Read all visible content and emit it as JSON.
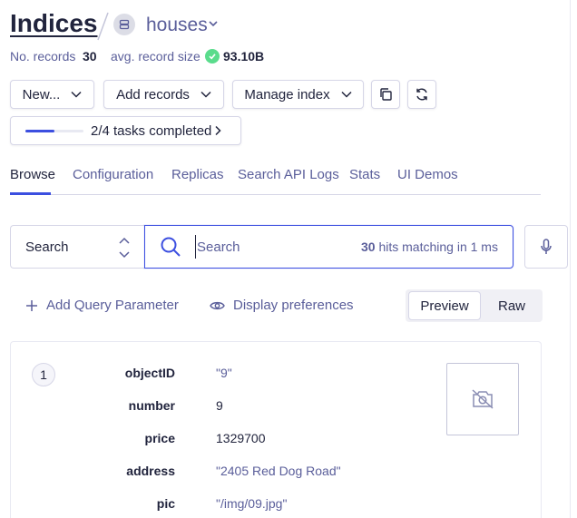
{
  "header": {
    "title": "Indices",
    "index_name": "houses",
    "records_label": "No. records",
    "records_value": "30",
    "size_label": "avg. record size",
    "size_value": "93.10B"
  },
  "toolbar": {
    "new_label": "New...",
    "add_records_label": "Add records",
    "manage_index_label": "Manage index"
  },
  "tasks": {
    "label": "2/4 tasks completed",
    "progress": 0.5
  },
  "tabs": [
    {
      "label": "Browse",
      "active": true
    },
    {
      "label": "Configuration",
      "active": false
    },
    {
      "label": "Replicas",
      "active": false
    },
    {
      "label": "Search API Logs",
      "active": false
    },
    {
      "label": "Stats",
      "active": false
    },
    {
      "label": "UI Demos",
      "active": false
    }
  ],
  "search": {
    "mode_label": "Search",
    "placeholder": "Search",
    "hits_count": "30",
    "hits_text": "hits matching in 1 ms"
  },
  "query": {
    "add_param_label": "Add Query Parameter",
    "display_prefs_label": "Display preferences",
    "preview_label": "Preview",
    "raw_label": "Raw"
  },
  "record": {
    "rank": "1",
    "fields": [
      {
        "key": "objectID",
        "value": "\"9\"",
        "is_string": true
      },
      {
        "key": "number",
        "value": "9",
        "is_string": false
      },
      {
        "key": "price",
        "value": "1329700",
        "is_string": false
      },
      {
        "key": "address",
        "value": "\"2405 Red Dog Road\"",
        "is_string": true
      },
      {
        "key": "pic",
        "value": "\"/img/09.jpg\"",
        "is_string": true
      }
    ]
  },
  "colors": {
    "accent": "#3c4fe0",
    "success": "#5adc8c",
    "text": "#21243d",
    "muted": "#5a5e9a"
  }
}
